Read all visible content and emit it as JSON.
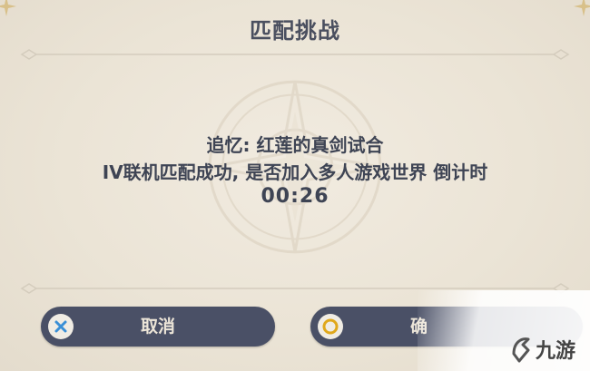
{
  "dialog": {
    "title": "匹配挑战",
    "line1": "追忆: 红莲的真剑试合",
    "line2": "IV联机匹配成功, 是否加入多人游戏世界 倒计时",
    "countdown": "00:26"
  },
  "buttons": {
    "cancel_label": "取消",
    "confirm_label": "确"
  },
  "watermark": {
    "brand": "九游"
  },
  "colors": {
    "background": "#ece5d8",
    "text": "#3e4454",
    "button": "#4a5066",
    "cancel_icon": "#3a8fd6",
    "confirm_icon": "#e0a81c"
  },
  "icons": {
    "cancel": "cross-icon",
    "confirm": "circle-icon",
    "corner": "star-icon",
    "emblem": "compass-emblem"
  }
}
